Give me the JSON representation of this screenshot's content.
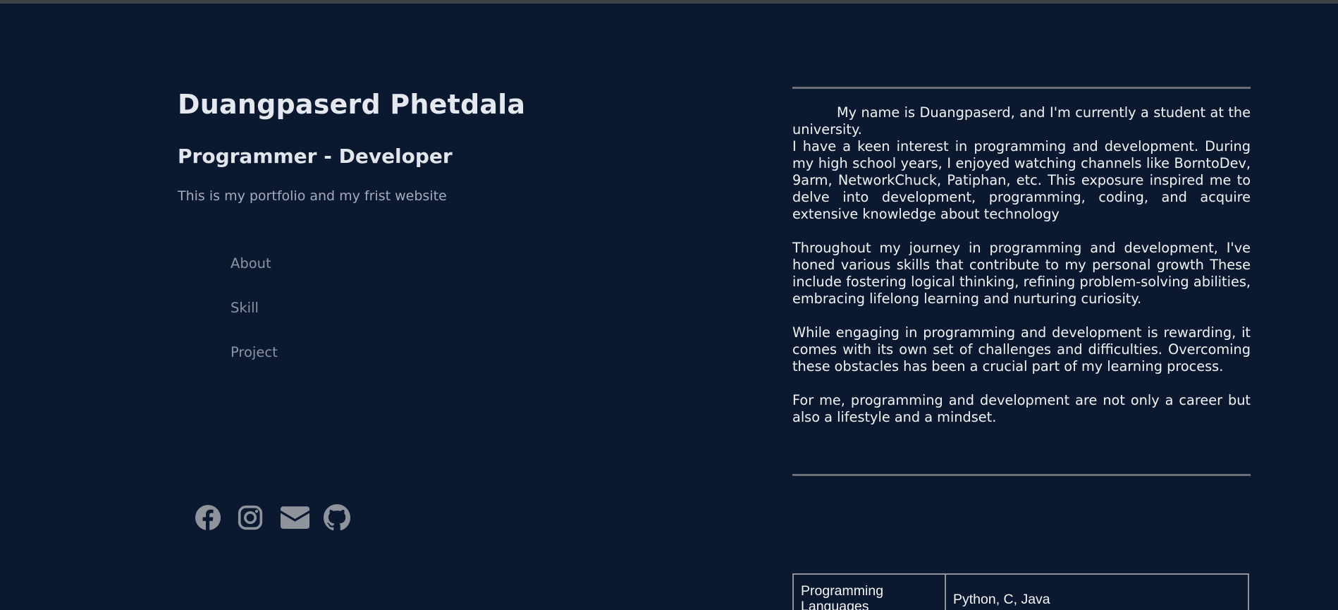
{
  "header": {
    "name": "Duangpaserd Phetdala",
    "role": "Programmer - Developer",
    "tagline": "This is my portfolio and my frist website"
  },
  "nav": {
    "items": [
      {
        "label": "About"
      },
      {
        "label": "Skill"
      },
      {
        "label": "Project"
      }
    ]
  },
  "socials": [
    {
      "icon": "facebook-icon"
    },
    {
      "icon": "instagram-icon"
    },
    {
      "icon": "envelope-icon"
    },
    {
      "icon": "github-icon"
    }
  ],
  "about": {
    "paragraphs": [
      "My name is Duangpaserd, and I'm currently a student at the university.",
      "I have a keen interest in programming and development. During my high school years, I enjoyed watching channels like BorntoDev, 9arm, NetworkChuck, Patiphan, etc. This exposure inspired me to delve into development, programming, coding, and acquire extensive knowledge about technology",
      "Throughout my journey in programming and development, I've honed various skills that contribute to my personal growth These include fostering logical thinking, refining problem-solving abilities, embracing lifelong learning and nurturing curiosity.",
      "While engaging in programming and development is rewarding, it comes with its own set of challenges and difficulties. Overcoming these obstacles has been a crucial part of my learning process.",
      "For me, programming and development are not only a career but also a lifestyle and a mindset."
    ]
  },
  "skills": {
    "rows": [
      {
        "key": "Programming Languages",
        "value": "Python, C, Java"
      }
    ]
  },
  "colors": {
    "background": "#0b1930",
    "nav_text": "#8b94a3",
    "icon": "#8f949c",
    "rule": "#6b6f76"
  }
}
